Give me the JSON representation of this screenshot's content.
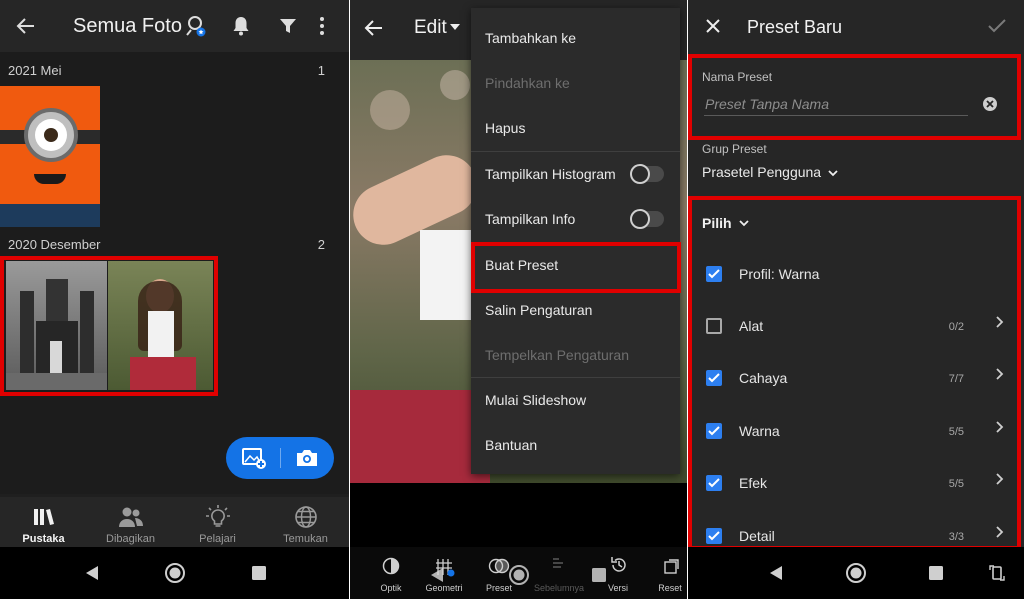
{
  "library": {
    "title": "Semua Foto",
    "groups": [
      {
        "date": "2021 Mei",
        "count": "1"
      },
      {
        "date": "2020 Desember",
        "count": "2"
      }
    ],
    "tabs": [
      {
        "label": "Pustaka",
        "icon": "library-icon"
      },
      {
        "label": "Dibagikan",
        "icon": "people-icon"
      },
      {
        "label": "Pelajari",
        "icon": "lightbulb-icon"
      },
      {
        "label": "Temukan",
        "icon": "globe-icon"
      }
    ]
  },
  "editor": {
    "title": "Edit",
    "menu": [
      {
        "label": "Tambahkan ke",
        "disabled": false
      },
      {
        "label": "Pindahkan ke",
        "disabled": true
      },
      {
        "label": "Hapus",
        "disabled": false
      },
      {
        "label": "Tampilkan Histogram",
        "disabled": false,
        "toggle": false
      },
      {
        "label": "Tampilkan Info",
        "disabled": false,
        "toggle": false
      },
      {
        "label": "Buat Preset",
        "disabled": false
      },
      {
        "label": "Salin Pengaturan",
        "disabled": false
      },
      {
        "label": "Tempelkan Pengaturan",
        "disabled": true
      },
      {
        "label": "Mulai Slideshow",
        "disabled": false
      },
      {
        "label": "Bantuan",
        "disabled": false
      }
    ],
    "tools": [
      "Optik",
      "Geometri",
      "Preset",
      "Sebelumnya",
      "Versi",
      "Reset"
    ]
  },
  "preset": {
    "title": "Preset Baru",
    "name_label": "Nama Preset",
    "name_placeholder": "Preset Tanpa Nama",
    "group_label": "Grup Preset",
    "group_value": "Prasetel Pengguna",
    "select_label": "Pilih",
    "items": [
      {
        "label": "Profil: Warna",
        "checked": true,
        "count": ""
      },
      {
        "label": "Alat",
        "checked": false,
        "count": "0/2"
      },
      {
        "label": "Cahaya",
        "checked": true,
        "count": "7/7"
      },
      {
        "label": "Warna",
        "checked": true,
        "count": "5/5"
      },
      {
        "label": "Efek",
        "checked": true,
        "count": "5/5"
      },
      {
        "label": "Detail",
        "checked": true,
        "count": "3/3"
      }
    ]
  },
  "colors": {
    "accent": "#1473e6",
    "highlight": "#e00000",
    "checkbox": "#2d7ff0"
  }
}
